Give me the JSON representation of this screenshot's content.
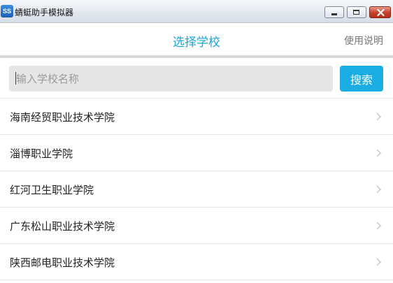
{
  "window": {
    "icon_text": "SS",
    "title": "蜻蜓助手模拟器",
    "buttons": [
      "minimize",
      "maximize",
      "close"
    ]
  },
  "header": {
    "title": "选择学校",
    "help": "使用说明"
  },
  "search": {
    "placeholder": "输入学校名称",
    "value": "",
    "button_label": "搜索"
  },
  "schools": [
    {
      "name": "海南经贸职业技术学院"
    },
    {
      "name": "淄博职业学院"
    },
    {
      "name": "红河卫生职业学院"
    },
    {
      "name": "广东松山职业技术学院"
    },
    {
      "name": "陕西邮电职业技术学院"
    }
  ],
  "colors": {
    "accent": "#1aa6d8",
    "button": "#1aade3",
    "divider": "#d9d9d9",
    "input_bg": "#e6e6e6"
  },
  "icons": {
    "row_chevron": "chevron-right-icon",
    "app": "app-logo-icon"
  }
}
